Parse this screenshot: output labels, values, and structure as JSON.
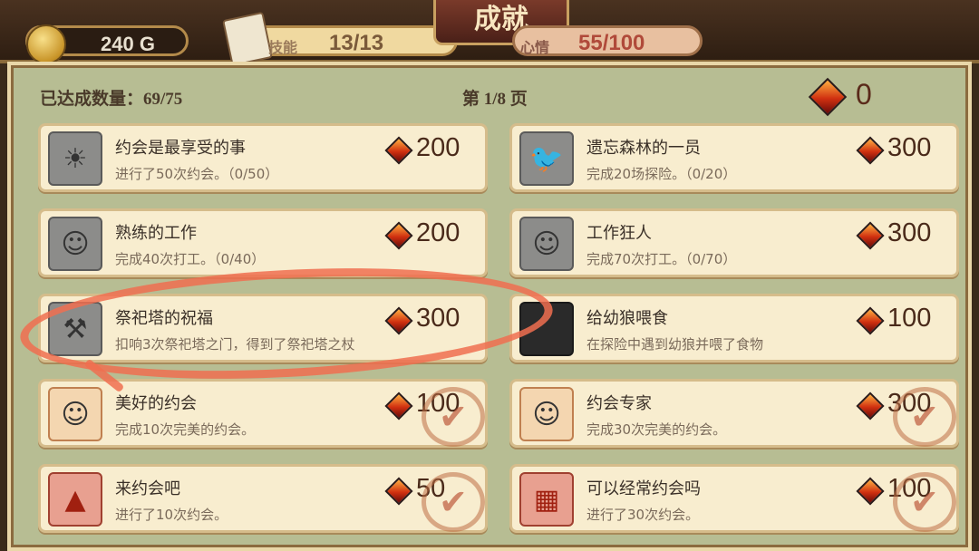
{
  "header": {
    "title": "成就",
    "gold": "240 G",
    "cards": "13/13",
    "cards_label": "技能",
    "heart": "55/100",
    "heart_label": "心情"
  },
  "status": {
    "achieved_count": "已达成数量：69/75",
    "page": "第 1/8 页",
    "total_gems": "0"
  },
  "achievements": [
    {
      "title": "约会是最享受的事",
      "desc": "进行了50次约会。（0/50）",
      "reward": "200",
      "icon": "sun-emblem-icon",
      "state": "locked"
    },
    {
      "title": "遗忘森林的一员",
      "desc": "完成20场探险。（0/20）",
      "reward": "300",
      "icon": "raven-icon",
      "state": "locked"
    },
    {
      "title": "熟练的工作",
      "desc": "完成40次打工。（0/40）",
      "reward": "200",
      "icon": "worker-portrait-icon",
      "state": "locked"
    },
    {
      "title": "工作狂人",
      "desc": "完成70次打工。（0/70）",
      "reward": "300",
      "icon": "girl-portrait-icon",
      "state": "locked"
    },
    {
      "title": "祭祀塔的祝福",
      "desc": "扣响3次祭祀塔之门，得到了祭祀塔之杖",
      "reward": "300",
      "icon": "staff-icon",
      "state": "locked"
    },
    {
      "title": "给幼狼喂食",
      "desc": "在探险中遇到幼狼并喂了食物",
      "reward": "100",
      "icon": "wolf-icon",
      "state": "dark"
    },
    {
      "title": "美好的约会",
      "desc": "完成10次完美的约会。",
      "reward": "100",
      "icon": "blonde-girl-icon",
      "state": "done"
    },
    {
      "title": "约会专家",
      "desc": "完成30次完美的约会。",
      "reward": "300",
      "icon": "brown-hair-girl-icon",
      "state": "done"
    },
    {
      "title": "来约会吧",
      "desc": "进行了10次约会。",
      "reward": "50",
      "icon": "dress-icon",
      "state": "done"
    },
    {
      "title": "可以经常约会吗",
      "desc": "进行了30次约会。",
      "reward": "100",
      "icon": "wardrobe-icon",
      "state": "done"
    }
  ]
}
